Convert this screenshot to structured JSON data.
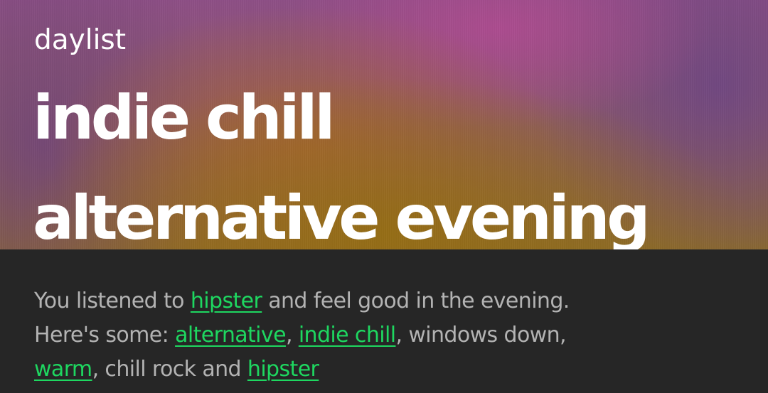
{
  "header": {
    "eyebrow": "daylist",
    "title_line_1": "indie chill",
    "title_line_2": "alternative evening"
  },
  "description": {
    "text_1": "You listened to ",
    "tag_1": "hipster",
    "text_2": " and feel good in the evening.",
    "text_3": "Here's some: ",
    "tag_2": "alternative",
    "text_4": ", ",
    "tag_3": "indie chill",
    "text_5": ", windows down,",
    "tag_4": "warm",
    "text_6": ", chill rock and ",
    "tag_5": "hipster"
  },
  "colors": {
    "background": "#262626",
    "text_secondary": "#b3b3b3",
    "tag_accent": "#1ed760",
    "title": "#ffffff"
  }
}
